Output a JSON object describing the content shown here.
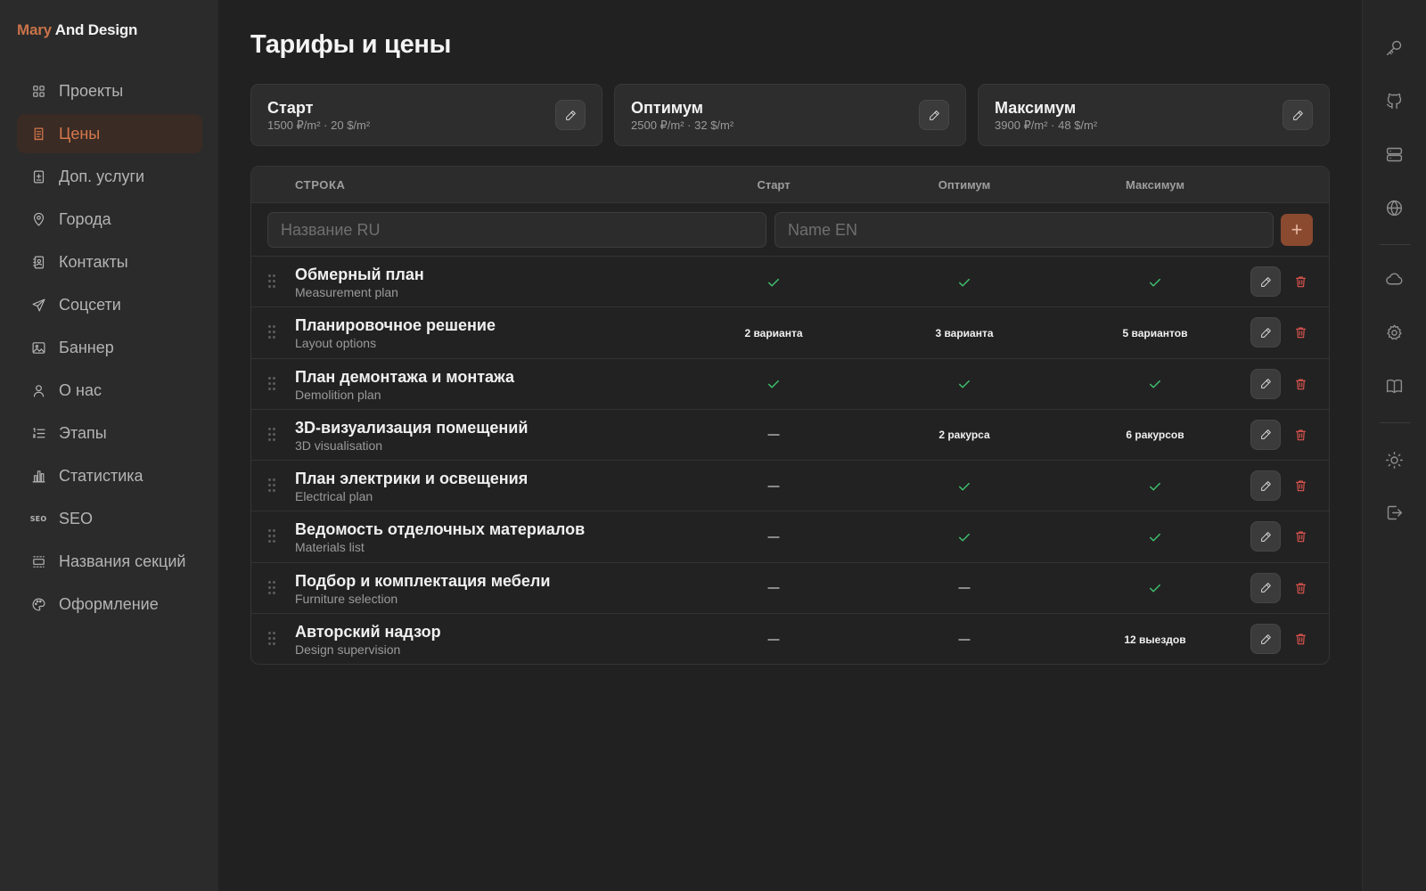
{
  "brand": {
    "part1": "Mary",
    "part2": " And Design"
  },
  "sidebar": {
    "items": [
      {
        "label": "Проекты",
        "icon": "grid-icon",
        "active": false
      },
      {
        "label": "Цены",
        "icon": "receipt-icon",
        "active": true
      },
      {
        "label": "Доп. услуги",
        "icon": "document-plus-icon",
        "active": false
      },
      {
        "label": "Города",
        "icon": "map-pin-icon",
        "active": false
      },
      {
        "label": "Контакты",
        "icon": "contacts-icon",
        "active": false
      },
      {
        "label": "Соцсети",
        "icon": "send-icon",
        "active": false
      },
      {
        "label": "Баннер",
        "icon": "image-icon",
        "active": false
      },
      {
        "label": "О нас",
        "icon": "user-icon",
        "active": false
      },
      {
        "label": "Этапы",
        "icon": "numbered-list-icon",
        "active": false
      },
      {
        "label": "Статистика",
        "icon": "bar-chart-icon",
        "active": false
      },
      {
        "label": "SEO",
        "icon": "seo-icon",
        "active": false
      },
      {
        "label": "Названия секций",
        "icon": "section-icon",
        "active": false
      },
      {
        "label": "Оформление",
        "icon": "palette-icon",
        "active": false
      }
    ],
    "seo_icon_text": "SEO"
  },
  "rail": {
    "icons": [
      "key-icon",
      "github-icon",
      "server-icon",
      "globe-icon",
      "cloud-icon",
      "settings-icon",
      "book-icon",
      "sun-icon",
      "logout-icon"
    ]
  },
  "page": {
    "title": "Тарифы и цены"
  },
  "plans": [
    {
      "name": "Старт",
      "price": "1500 ₽/m² · 20 $/m²"
    },
    {
      "name": "Оптимум",
      "price": "2500 ₽/m² · 32 $/m²"
    },
    {
      "name": "Максимум",
      "price": "3900 ₽/m² · 48 $/m²"
    }
  ],
  "table": {
    "headers": {
      "row": "СТРОКА",
      "c1": "Старт",
      "c2": "Оптимум",
      "c3": "Максимум"
    },
    "add": {
      "ru_placeholder": "Название RU",
      "en_placeholder": "Name EN",
      "add_label": "+"
    },
    "rows": [
      {
        "title": "Обмерный план",
        "subtitle": "Measurement plan",
        "cells": [
          "check",
          "check",
          "check"
        ]
      },
      {
        "title": "Планировочное решение",
        "subtitle": "Layout options",
        "cells": [
          "2 варианта",
          "3 варианта",
          "5 вариантов"
        ]
      },
      {
        "title": "План демонтажа и монтажа",
        "subtitle": "Demolition plan",
        "cells": [
          "check",
          "check",
          "check"
        ]
      },
      {
        "title": "3D-визуализация помещений",
        "subtitle": "3D visualisation",
        "cells": [
          "dash",
          "2 ракурса",
          "6 ракурсов"
        ]
      },
      {
        "title": "План электрики и освещения",
        "subtitle": "Electrical plan",
        "cells": [
          "dash",
          "check",
          "check"
        ]
      },
      {
        "title": "Ведомость отделочных материалов",
        "subtitle": "Materials list",
        "cells": [
          "dash",
          "check",
          "check"
        ]
      },
      {
        "title": "Подбор и комплектация мебели",
        "subtitle": "Furniture selection",
        "cells": [
          "dash",
          "dash",
          "check"
        ]
      },
      {
        "title": "Авторский надзор",
        "subtitle": "Design supervision",
        "cells": [
          "dash",
          "dash",
          "12 выездов"
        ]
      }
    ]
  },
  "colors": {
    "accent": "#d5784c",
    "check": "#3fbf6e",
    "danger": "#e0554f",
    "background": "#212121"
  }
}
